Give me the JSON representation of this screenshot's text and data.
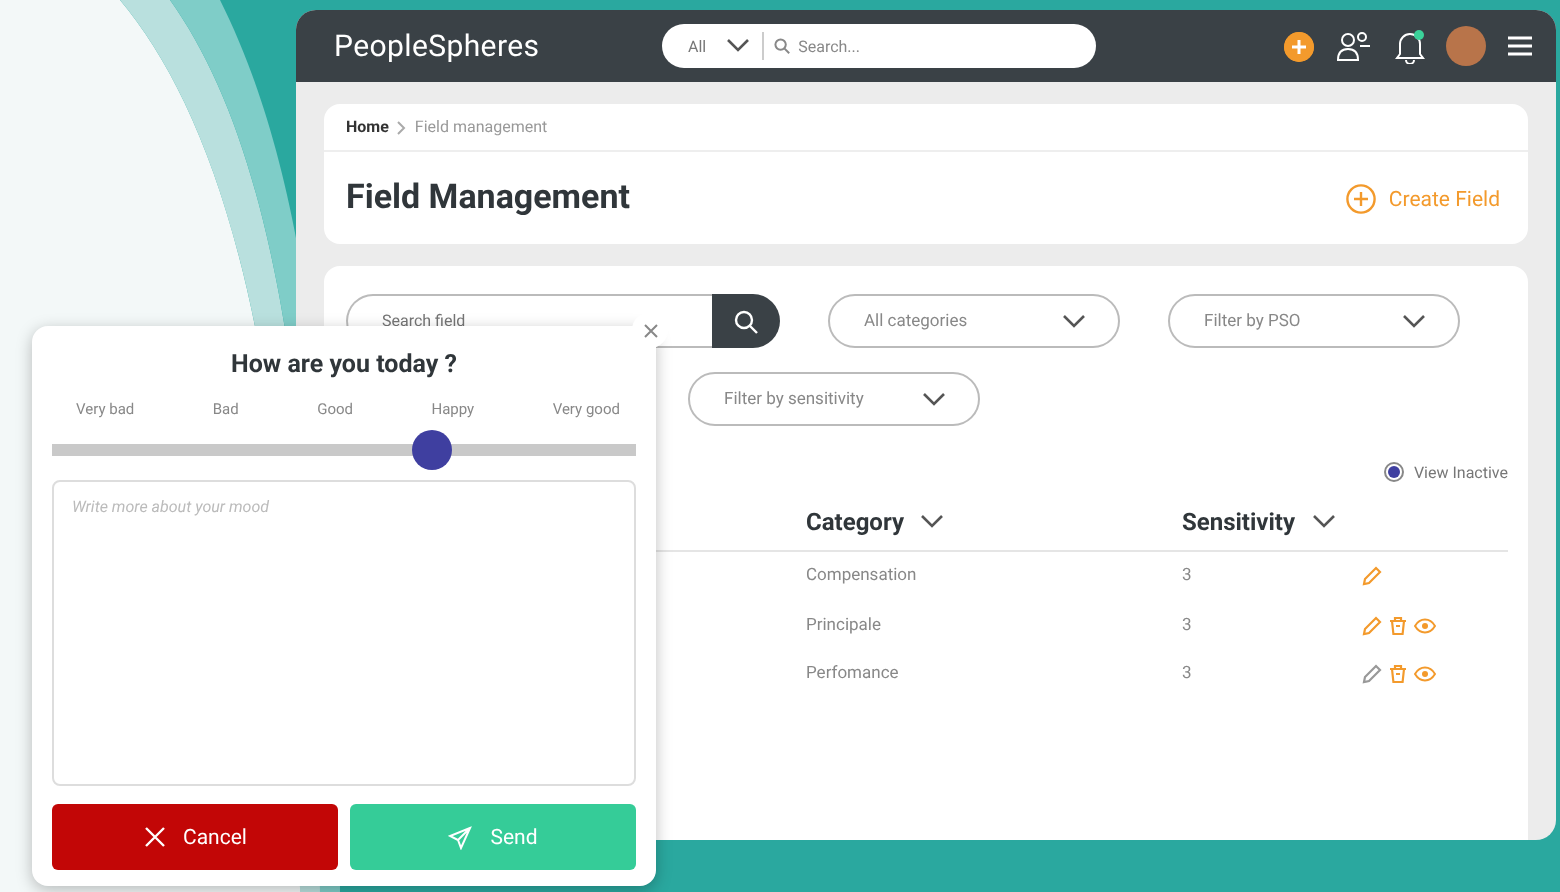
{
  "topbar": {
    "logo": "PeopleSpheres",
    "search": {
      "scope": "All",
      "placeholder": "Search..."
    },
    "notification_dot": true
  },
  "breadcrumb": [
    {
      "label": "Home",
      "current": false
    },
    {
      "label": "Field management",
      "current": true
    }
  ],
  "page_title": "Field Management",
  "create_button": "Create Field",
  "filters": {
    "search_placeholder": "Search field",
    "dropdowns": [
      "All categories",
      "Filter by PSO",
      "Filter by sensitivity"
    ]
  },
  "view_inactive": {
    "label": "View Inactive",
    "selected": true
  },
  "table": {
    "columns": [
      "Category",
      "Sensitivity"
    ],
    "rows": [
      {
        "category": "Compensation",
        "sensitivity": "3",
        "actions": [
          {
            "kind": "edit",
            "disabled": false
          }
        ]
      },
      {
        "category": "Principale",
        "sensitivity": "3",
        "actions": [
          {
            "kind": "edit",
            "disabled": false
          },
          {
            "kind": "delete",
            "disabled": false
          },
          {
            "kind": "view",
            "disabled": false
          }
        ]
      },
      {
        "category": "Perfomance",
        "sensitivity": "3",
        "actions": [
          {
            "kind": "edit",
            "disabled": true
          },
          {
            "kind": "delete",
            "disabled": false
          },
          {
            "kind": "view",
            "disabled": false
          }
        ]
      }
    ]
  },
  "mood_dialog": {
    "title": "How are you today ?",
    "scale": [
      "Very bad",
      "Bad",
      "Good",
      "Happy",
      "Very good"
    ],
    "level": 0.65,
    "placeholder": "Write more about your mood",
    "buttons": [
      {
        "kind": "cancel",
        "label": "Cancel"
      },
      {
        "kind": "send",
        "label": "Send"
      }
    ]
  }
}
